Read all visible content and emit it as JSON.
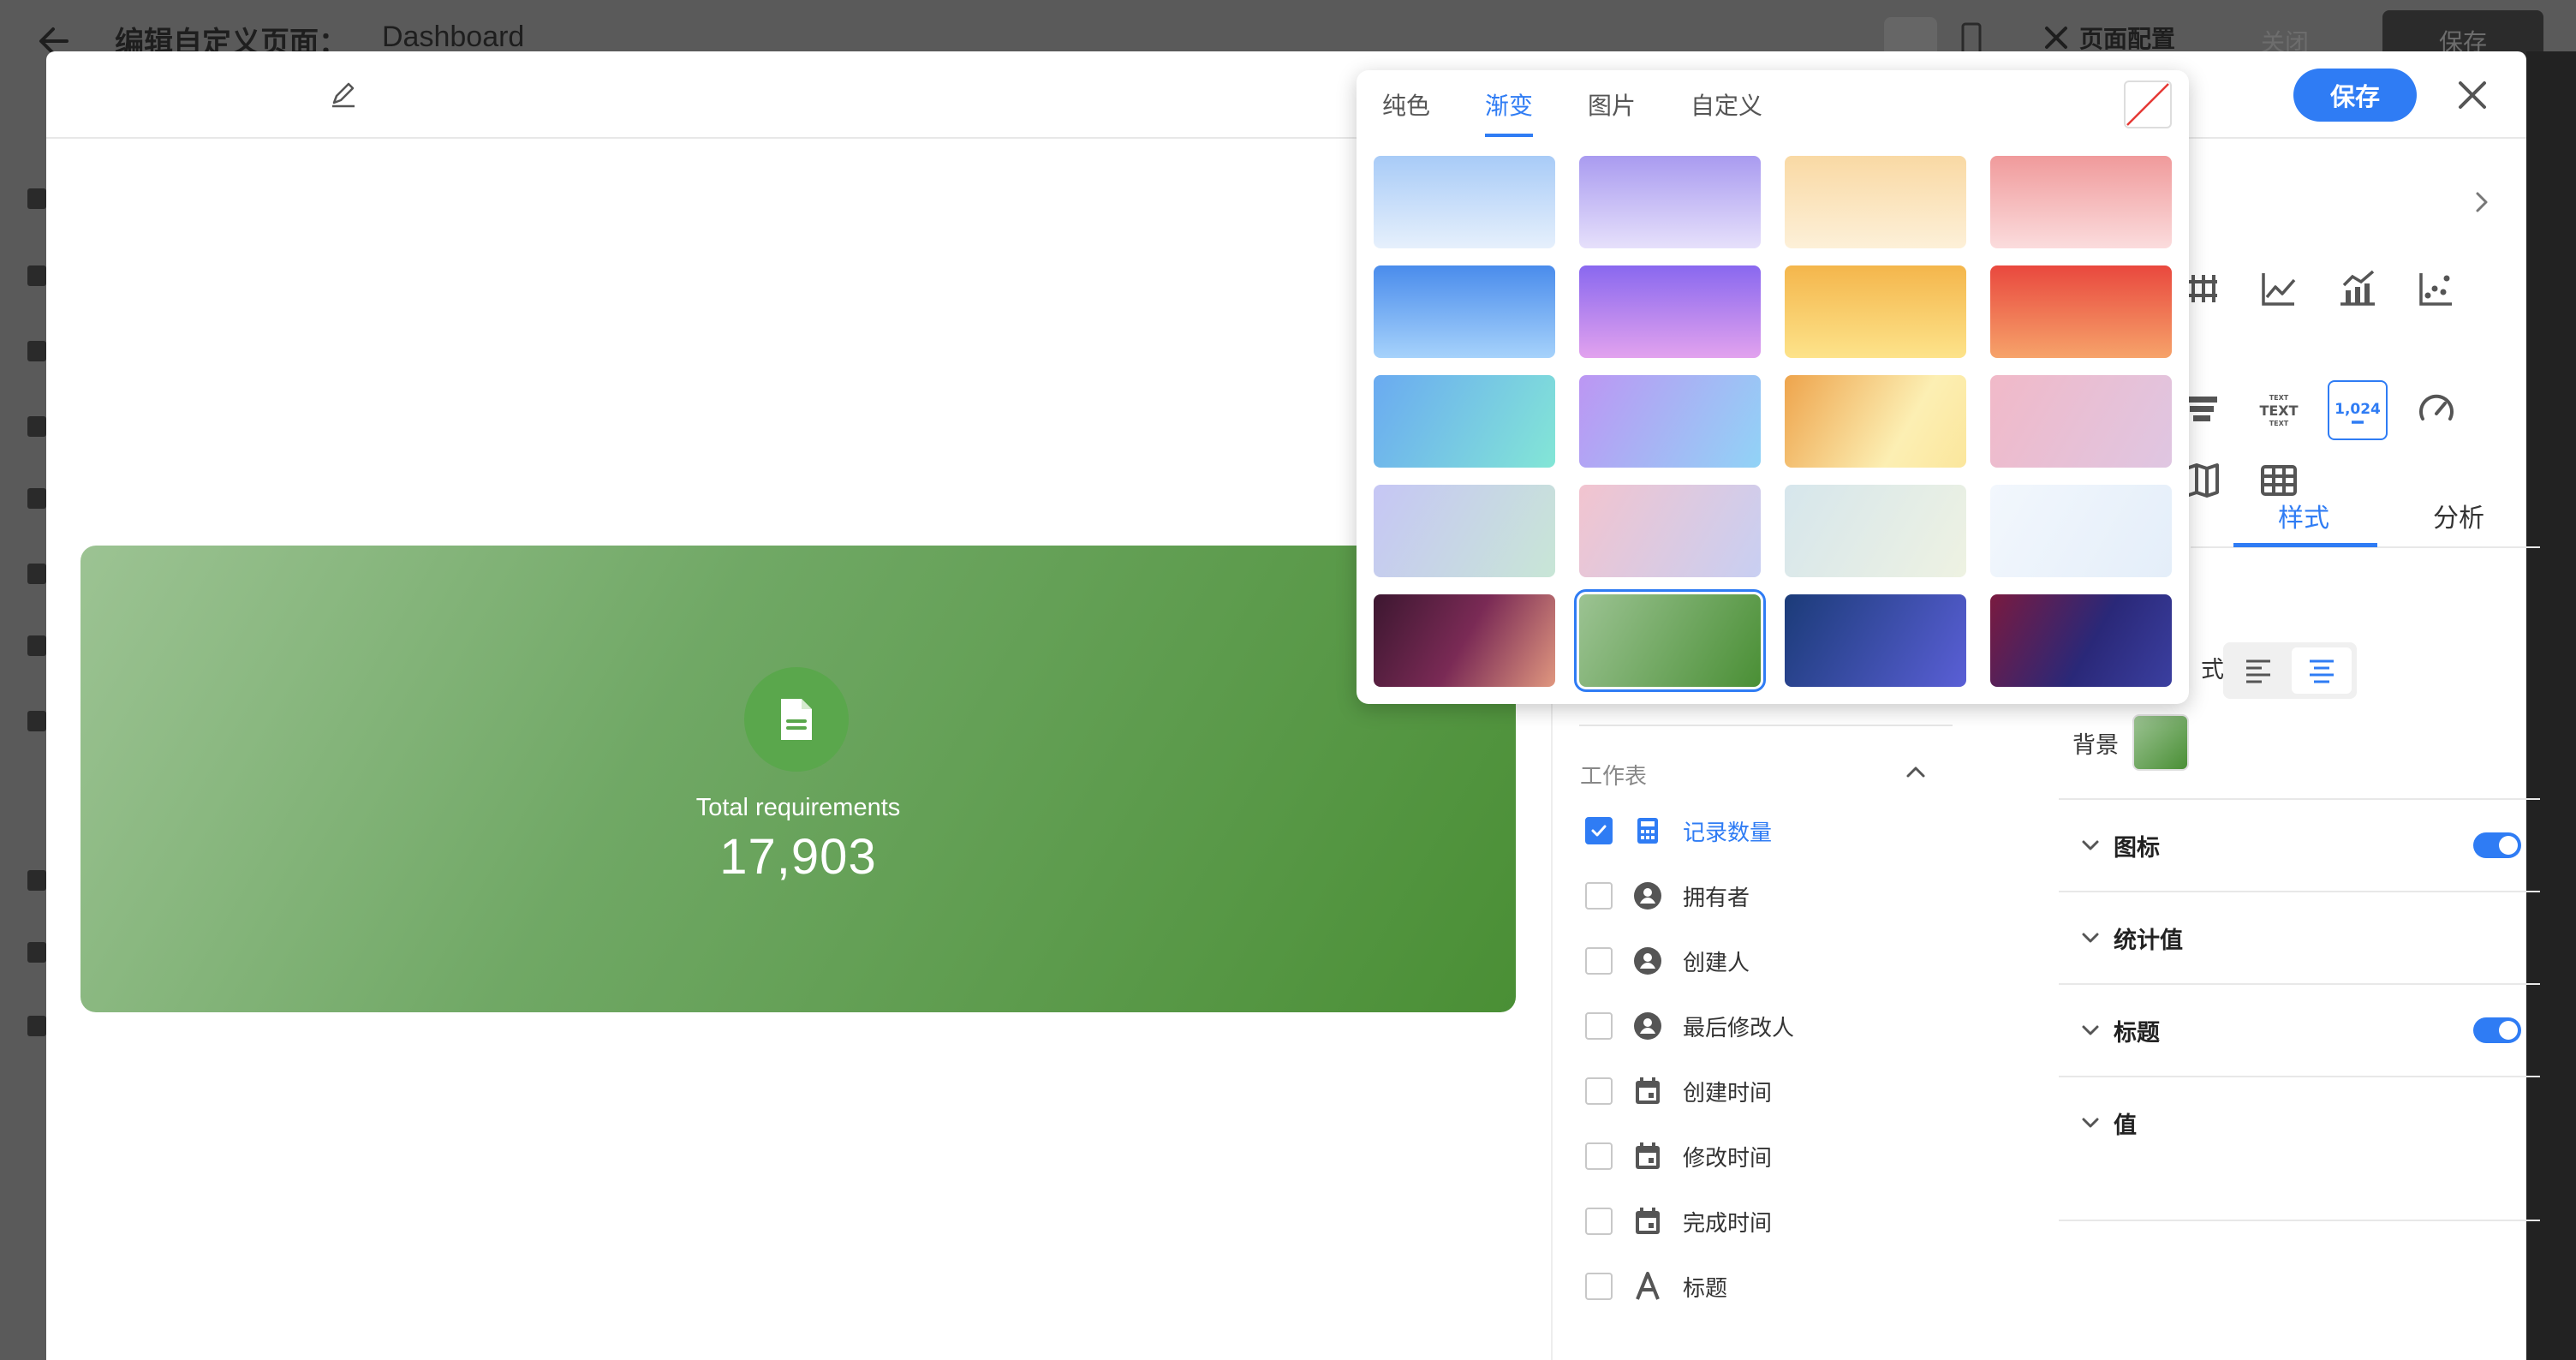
{
  "bg_header": {
    "title": "编辑自定义页面：",
    "page_name": "Dashboard",
    "page_config": "页面配置",
    "close": "关闭",
    "save": "保存"
  },
  "modal": {
    "save": "保存"
  },
  "card": {
    "label": "Total requirements",
    "value": "17,903",
    "background": "#4a8f35"
  },
  "worksheet": {
    "title": "工作表",
    "fields": [
      {
        "label": "记录数量",
        "icon": "calculator-icon",
        "checked": true
      },
      {
        "label": "拥有者",
        "icon": "person-icon",
        "checked": false
      },
      {
        "label": "创建人",
        "icon": "person-icon",
        "checked": false
      },
      {
        "label": "最后修改人",
        "icon": "person-icon",
        "checked": false
      },
      {
        "label": "创建时间",
        "icon": "calendar-icon",
        "checked": false
      },
      {
        "label": "修改时间",
        "icon": "calendar-icon",
        "checked": false
      },
      {
        "label": "完成时间",
        "icon": "calendar-icon",
        "checked": false
      },
      {
        "label": "标题",
        "icon": "text-a-icon",
        "checked": false
      }
    ]
  },
  "right_panel": {
    "numeric_chart_label": "1,024",
    "text_chart_label": "TEXT",
    "tabs": [
      "样式",
      "分析"
    ],
    "style_suffix": "式",
    "background_label": "背景",
    "sections": [
      {
        "label": "图标",
        "toggle": true
      },
      {
        "label": "统计值",
        "toggle": false
      },
      {
        "label": "标题",
        "toggle": true
      },
      {
        "label": "值",
        "toggle": false
      }
    ]
  },
  "color_popup": {
    "tabs": [
      "纯色",
      "渐变",
      "图片",
      "自定义"
    ],
    "active_tab": "渐变",
    "selected_swatch": 17,
    "accent": "#2f7cf4"
  }
}
